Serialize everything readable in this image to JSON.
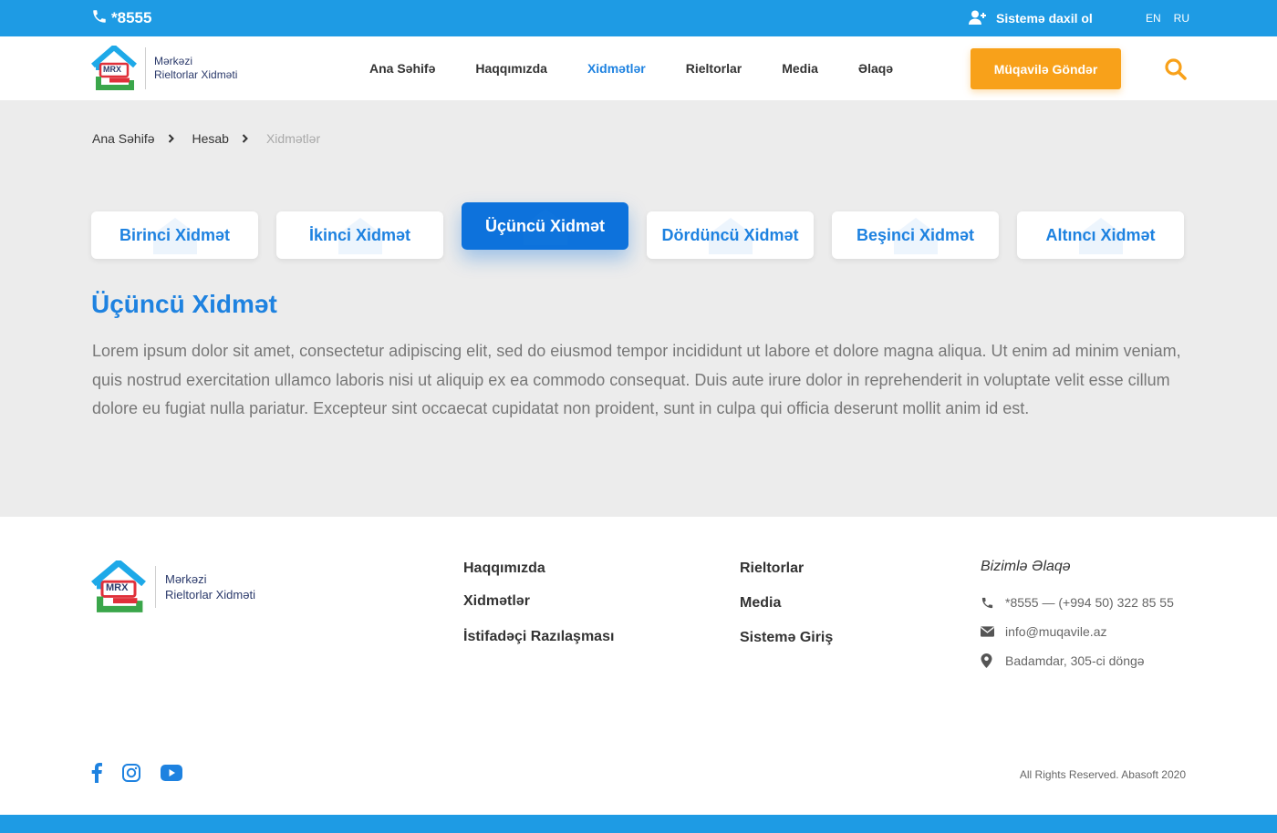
{
  "topbar": {
    "phone": "*8555",
    "login_label": "Sistemə daxil ol",
    "languages": [
      "EN",
      "RU"
    ]
  },
  "logo": {
    "mark_text": "MRX",
    "line1": "Mərkəzi",
    "line2": "Rieltorlar Xidməti"
  },
  "nav": {
    "items": [
      "Ana Səhifə",
      "Haqqımızda",
      "Xidmətlər",
      "Rieltorlar",
      "Media",
      "Əlaqə"
    ],
    "active": "Xidmətlər",
    "cta_label": "Müqavilə Göndər"
  },
  "breadcrumb": [
    "Ana Səhifə",
    "Hesab",
    "Xidmətlər"
  ],
  "tabs": {
    "items": [
      "Birinci Xidmət",
      "İkinci Xidmət",
      "Üçüncü Xidmət",
      "Dördüncü Xidmət",
      "Beşinci Xidmət",
      "Altıncı Xidmət"
    ],
    "active_index": 2
  },
  "content": {
    "title": "Üçüncü Xidmət",
    "text": "Lorem ipsum dolor sit amet, consectetur adipiscing elit, sed do eiusmod tempor incididunt ut labore et dolore magna aliqua. Ut enim ad minim veniam, quis nostrud exercitation ullamco laboris nisi ut aliquip ex ea commodo consequat. Duis aute irure dolor in reprehenderit in voluptate velit esse cillum dolore eu fugiat nulla pariatur. Excepteur sint occaecat cupidatat non proident, sunt in culpa qui officia deserunt mollit anim id est."
  },
  "footer": {
    "col1": [
      "Haqqımızda",
      "Xidmətlər",
      "İstifadəçi Razılaşması"
    ],
    "col2": [
      "Rieltorlar",
      "Media",
      "Sistemə Giriş"
    ],
    "contact_title": "Bizimlə Əlaqə",
    "phone": "*8555 — (+994 50) 322 85 55",
    "email": "info@muqavile.az",
    "address": "Badamdar, 305-ci döngə",
    "social": [
      "facebook-icon",
      "instagram-icon",
      "youtube-icon"
    ],
    "copyright": "All Rights Reserved. Abasoft 2020"
  },
  "colors": {
    "primary": "#1e9be4",
    "accent_blue": "#1e82e0",
    "active_tab": "#0d72dc",
    "orange": "#f8a11a"
  }
}
